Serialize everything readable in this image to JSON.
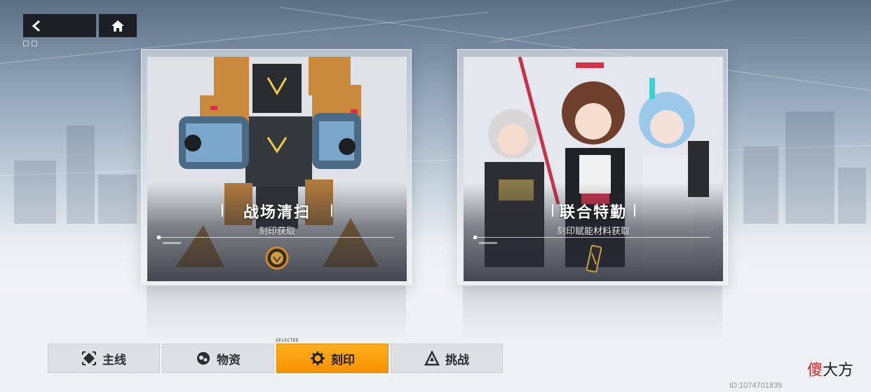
{
  "nav": {
    "back_icon": "chevron-left-icon",
    "home_icon": "home-icon"
  },
  "cards": [
    {
      "title": "战场清扫",
      "subtitle": "刻印获取",
      "emblem_icon": "lion-emblem-icon"
    },
    {
      "title": "联合特勤",
      "subtitle": "刻印赋能材料获取",
      "emblem_icon": "chip-item-icon"
    }
  ],
  "tabs": [
    {
      "label": "主线",
      "icon": "mainline-icon",
      "active": false
    },
    {
      "label": "物资",
      "icon": "supplies-icon",
      "active": false
    },
    {
      "label": "刻印",
      "icon": "engraving-gear-icon",
      "active": true
    },
    {
      "label": "挑战",
      "icon": "challenge-icon",
      "active": false
    }
  ],
  "selected_tag": "SELECTED",
  "player_id": "ID:1074701835",
  "watermark": {
    "part1": "傻",
    "part2": "大方"
  },
  "colors": {
    "active_tab": "#f79200",
    "dark_button": "#1c1f24",
    "watermark_red": "#d92020"
  }
}
